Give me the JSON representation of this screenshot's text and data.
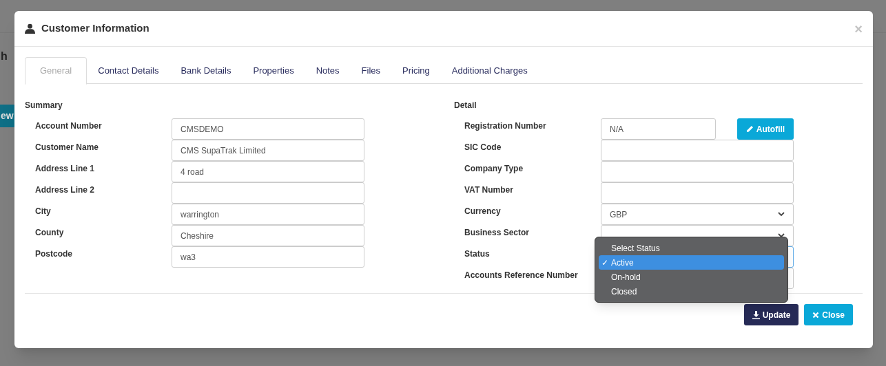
{
  "background": {
    "heading_fragment": "h",
    "button_fragment": "ew"
  },
  "window": {
    "title": "Customer Information",
    "close": "×"
  },
  "tabs": [
    {
      "label": "General",
      "selected": true
    },
    {
      "label": "Contact Details",
      "selected": false
    },
    {
      "label": "Bank Details",
      "selected": false
    },
    {
      "label": "Properties",
      "selected": false
    },
    {
      "label": "Notes",
      "selected": false
    },
    {
      "label": "Files",
      "selected": false
    },
    {
      "label": "Pricing",
      "selected": false
    },
    {
      "label": "Additional Charges",
      "selected": false
    }
  ],
  "summary": {
    "heading": "Summary",
    "fields": [
      {
        "label": "Account Number",
        "kind": "text",
        "value": "CMSDEMO"
      },
      {
        "label": "Customer Name",
        "kind": "text",
        "value": "CMS SupaTrak Limited"
      },
      {
        "label": "Address Line 1",
        "kind": "text",
        "value": "4 road"
      },
      {
        "label": "Address Line 2",
        "kind": "text"
      },
      {
        "label": "City",
        "kind": "text",
        "value": "warrington"
      },
      {
        "label": "County",
        "kind": "text",
        "value": "Cheshire"
      },
      {
        "label": "Postcode",
        "kind": "text",
        "value": "wa3"
      }
    ]
  },
  "detail": {
    "heading": "Detail",
    "autofill": "Autofill",
    "fields": [
      {
        "label": "Registration Number",
        "kind": "text",
        "value": "N/A",
        "focused": false
      },
      {
        "label": "SIC Code",
        "kind": "text",
        "focused": false
      },
      {
        "label": "Company Type",
        "kind": "text",
        "focused": false
      },
      {
        "label": "VAT Number",
        "kind": "text",
        "focused": false
      },
      {
        "label": "Currency",
        "kind": "select",
        "value": "GBP",
        "focused": false
      },
      {
        "label": "Business Sector",
        "kind": "select",
        "focused": false
      },
      {
        "label": "Status",
        "kind": "select",
        "focused": true
      },
      {
        "label": "Accounts Reference Number",
        "kind": "text",
        "focused": false
      }
    ]
  },
  "status_dropdown": {
    "check": "✓",
    "options": [
      {
        "label": "Select Status",
        "selected": false
      },
      {
        "label": "Active",
        "selected": true
      },
      {
        "label": "On-hold",
        "selected": false
      },
      {
        "label": "Closed",
        "selected": false
      }
    ]
  },
  "buttons": [
    {
      "kind": "update",
      "label": "Update"
    },
    {
      "kind": "close",
      "label": "Close"
    }
  ]
}
